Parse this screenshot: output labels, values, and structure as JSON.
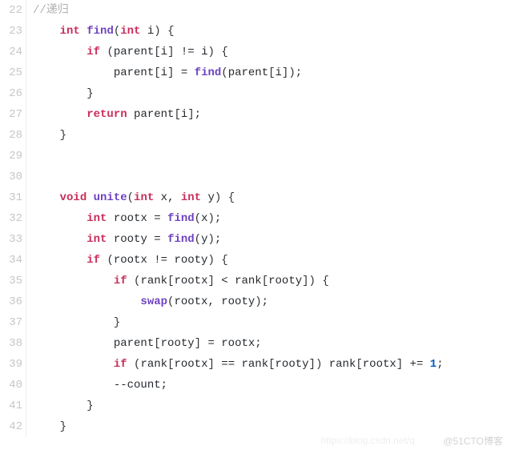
{
  "lines": [
    {
      "num": "22",
      "tokens": [
        [
          "cmt",
          "//递归"
        ]
      ]
    },
    {
      "num": "23",
      "tokens": [
        [
          "txt",
          "    "
        ],
        [
          "kw",
          "int"
        ],
        [
          "txt",
          " "
        ],
        [
          "fn",
          "find"
        ],
        [
          "paren",
          "("
        ],
        [
          "kw",
          "int"
        ],
        [
          "txt",
          " i"
        ],
        [
          "paren",
          ")"
        ],
        [
          "txt",
          " "
        ],
        [
          "paren",
          "{"
        ]
      ]
    },
    {
      "num": "24",
      "tokens": [
        [
          "txt",
          "        "
        ],
        [
          "kw",
          "if"
        ],
        [
          "txt",
          " "
        ],
        [
          "paren",
          "("
        ],
        [
          "txt",
          "parent"
        ],
        [
          "paren",
          "["
        ],
        [
          "txt",
          "i"
        ],
        [
          "paren",
          "]"
        ],
        [
          "txt",
          " != i"
        ],
        [
          "paren",
          ")"
        ],
        [
          "txt",
          " "
        ],
        [
          "paren",
          "{"
        ]
      ]
    },
    {
      "num": "25",
      "tokens": [
        [
          "txt",
          "            parent"
        ],
        [
          "paren",
          "["
        ],
        [
          "txt",
          "i"
        ],
        [
          "paren",
          "]"
        ],
        [
          "txt",
          " = "
        ],
        [
          "fn",
          "find"
        ],
        [
          "paren",
          "("
        ],
        [
          "txt",
          "parent"
        ],
        [
          "paren",
          "["
        ],
        [
          "txt",
          "i"
        ],
        [
          "paren",
          "]"
        ],
        [
          "paren",
          ")"
        ],
        [
          "txt",
          ";"
        ]
      ]
    },
    {
      "num": "26",
      "tokens": [
        [
          "txt",
          "        "
        ],
        [
          "paren",
          "}"
        ]
      ]
    },
    {
      "num": "27",
      "tokens": [
        [
          "txt",
          "        "
        ],
        [
          "kw",
          "return"
        ],
        [
          "txt",
          " parent"
        ],
        [
          "paren",
          "["
        ],
        [
          "txt",
          "i"
        ],
        [
          "paren",
          "]"
        ],
        [
          "txt",
          ";"
        ]
      ]
    },
    {
      "num": "28",
      "tokens": [
        [
          "txt",
          "    "
        ],
        [
          "paren",
          "}"
        ]
      ]
    },
    {
      "num": "29",
      "tokens": [
        [
          "txt",
          ""
        ]
      ]
    },
    {
      "num": "30",
      "tokens": [
        [
          "txt",
          ""
        ]
      ]
    },
    {
      "num": "31",
      "tokens": [
        [
          "txt",
          "    "
        ],
        [
          "kw",
          "void"
        ],
        [
          "txt",
          " "
        ],
        [
          "fn",
          "unite"
        ],
        [
          "paren",
          "("
        ],
        [
          "kw",
          "int"
        ],
        [
          "txt",
          " x, "
        ],
        [
          "kw",
          "int"
        ],
        [
          "txt",
          " y"
        ],
        [
          "paren",
          ")"
        ],
        [
          "txt",
          " "
        ],
        [
          "paren",
          "{"
        ]
      ]
    },
    {
      "num": "32",
      "tokens": [
        [
          "txt",
          "        "
        ],
        [
          "kw",
          "int"
        ],
        [
          "txt",
          " rootx = "
        ],
        [
          "fn",
          "find"
        ],
        [
          "paren",
          "("
        ],
        [
          "txt",
          "x"
        ],
        [
          "paren",
          ")"
        ],
        [
          "txt",
          ";"
        ]
      ]
    },
    {
      "num": "33",
      "tokens": [
        [
          "txt",
          "        "
        ],
        [
          "kw",
          "int"
        ],
        [
          "txt",
          " rooty = "
        ],
        [
          "fn",
          "find"
        ],
        [
          "paren",
          "("
        ],
        [
          "txt",
          "y"
        ],
        [
          "paren",
          ")"
        ],
        [
          "txt",
          ";"
        ]
      ]
    },
    {
      "num": "34",
      "tokens": [
        [
          "txt",
          "        "
        ],
        [
          "kw",
          "if"
        ],
        [
          "txt",
          " "
        ],
        [
          "paren",
          "("
        ],
        [
          "txt",
          "rootx != rooty"
        ],
        [
          "paren",
          ")"
        ],
        [
          "txt",
          " "
        ],
        [
          "paren",
          "{"
        ]
      ]
    },
    {
      "num": "35",
      "tokens": [
        [
          "txt",
          "            "
        ],
        [
          "kw",
          "if"
        ],
        [
          "txt",
          " "
        ],
        [
          "paren",
          "("
        ],
        [
          "txt",
          "rank"
        ],
        [
          "paren",
          "["
        ],
        [
          "txt",
          "rootx"
        ],
        [
          "paren",
          "]"
        ],
        [
          "txt",
          " < rank"
        ],
        [
          "paren",
          "["
        ],
        [
          "txt",
          "rooty"
        ],
        [
          "paren",
          "]"
        ],
        [
          "paren",
          ")"
        ],
        [
          "txt",
          " "
        ],
        [
          "paren",
          "{"
        ]
      ]
    },
    {
      "num": "36",
      "tokens": [
        [
          "txt",
          "                "
        ],
        [
          "fn",
          "swap"
        ],
        [
          "paren",
          "("
        ],
        [
          "txt",
          "rootx, rooty"
        ],
        [
          "paren",
          ")"
        ],
        [
          "txt",
          ";"
        ]
      ]
    },
    {
      "num": "37",
      "tokens": [
        [
          "txt",
          "            "
        ],
        [
          "paren",
          "}"
        ]
      ]
    },
    {
      "num": "38",
      "tokens": [
        [
          "txt",
          "            parent"
        ],
        [
          "paren",
          "["
        ],
        [
          "txt",
          "rooty"
        ],
        [
          "paren",
          "]"
        ],
        [
          "txt",
          " = rootx;"
        ]
      ]
    },
    {
      "num": "39",
      "tokens": [
        [
          "txt",
          "            "
        ],
        [
          "kw",
          "if"
        ],
        [
          "txt",
          " "
        ],
        [
          "paren",
          "("
        ],
        [
          "txt",
          "rank"
        ],
        [
          "paren",
          "["
        ],
        [
          "txt",
          "rootx"
        ],
        [
          "paren",
          "]"
        ],
        [
          "txt",
          " == rank"
        ],
        [
          "paren",
          "["
        ],
        [
          "txt",
          "rooty"
        ],
        [
          "paren",
          "]"
        ],
        [
          "paren",
          ")"
        ],
        [
          "txt",
          " rank"
        ],
        [
          "paren",
          "["
        ],
        [
          "txt",
          "rootx"
        ],
        [
          "paren",
          "]"
        ],
        [
          "txt",
          " += "
        ],
        [
          "num",
          "1"
        ],
        [
          "txt",
          ";"
        ]
      ]
    },
    {
      "num": "40",
      "tokens": [
        [
          "txt",
          "            --count;"
        ]
      ]
    },
    {
      "num": "41",
      "tokens": [
        [
          "txt",
          "        "
        ],
        [
          "paren",
          "}"
        ]
      ]
    },
    {
      "num": "42",
      "tokens": [
        [
          "txt",
          "    "
        ],
        [
          "paren",
          "}"
        ]
      ]
    }
  ],
  "watermark": "@51CTO博客",
  "watermark2": "https://blog.csdn.net/q"
}
